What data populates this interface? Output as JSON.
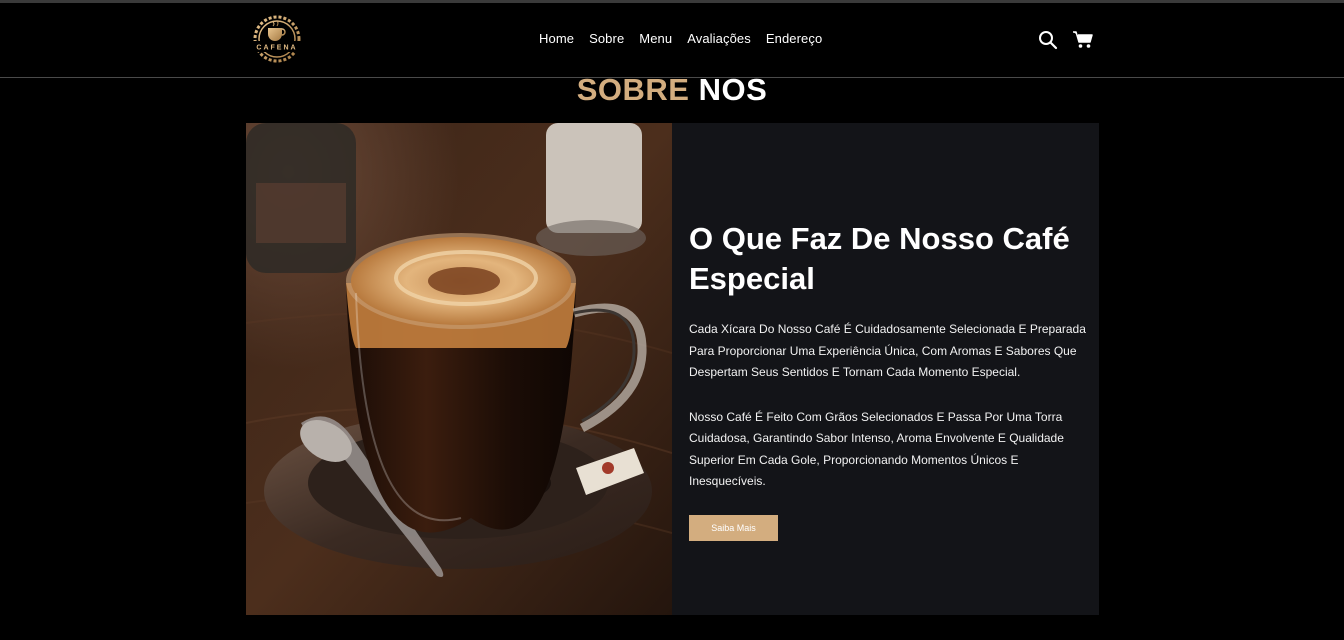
{
  "header": {
    "logo_text": "CAFENA",
    "nav": [
      "Home",
      "Sobre",
      "Menu",
      "Avaliações",
      "Endereço"
    ],
    "icons": {
      "search": "search-icon",
      "cart": "cart-icon"
    }
  },
  "about": {
    "title_accent": "SOBRE",
    "title_rest": "NOS",
    "heading": "O Que Faz De Nosso Café Especial",
    "paragraph_1": "Cada Xícara Do Nosso Café É Cuidadosamente Selecionada E Preparada Para Proporcionar Uma Experiência Única, Com Aromas E Sabores Que Despertam Seus Sentidos E Tornam Cada Momento Especial.",
    "paragraph_2": "Nosso Café É Feito Com Grãos Selecionados E Passa Por Uma Torra Cuidadosa, Garantindo Sabor Intenso, Aroma Envolvente E Qualidade Superior Em Cada Gole, Proporcionando Momentos Únicos E Inesquecíveis.",
    "button_label": "Saiba Mais"
  },
  "colors": {
    "accent": "#d3ad7f",
    "card_bg": "#131418",
    "page_bg": "#000000"
  }
}
